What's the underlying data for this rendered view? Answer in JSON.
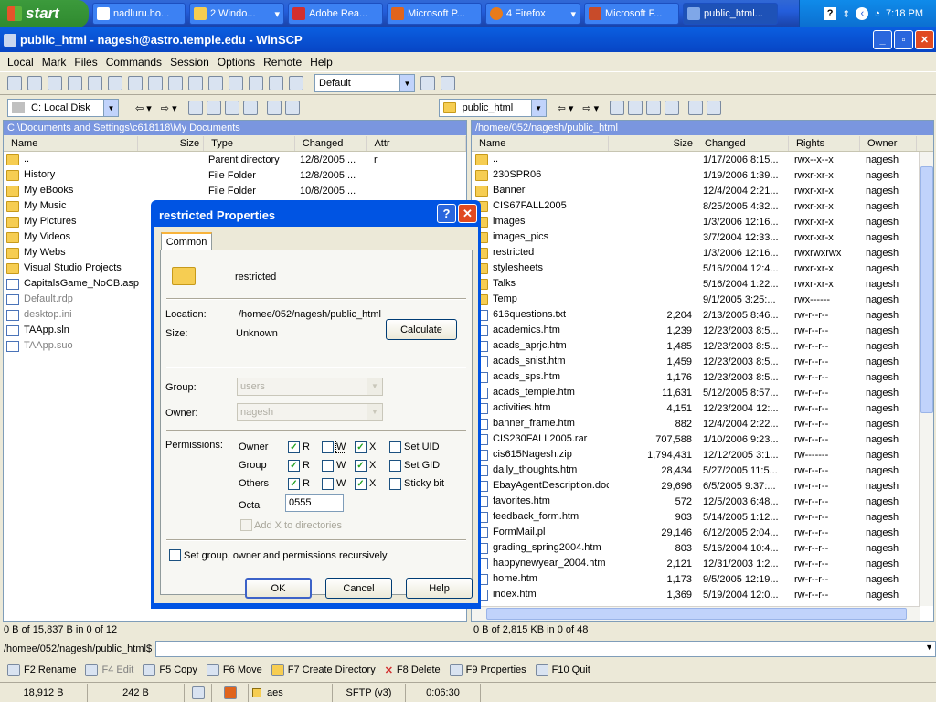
{
  "taskbar": {
    "start": "start",
    "buttons": [
      "nadluru.ho...",
      "2 Windo...",
      "Adobe Rea...",
      "Microsoft P...",
      "4 Firefox",
      "Microsoft F...",
      "public_html..."
    ],
    "time": "7:18 PM"
  },
  "window": {
    "title": "public_html - nagesh@astro.temple.edu - WinSCP"
  },
  "menu": {
    "items": [
      "Local",
      "Mark",
      "Files",
      "Commands",
      "Session",
      "Options",
      "Remote",
      "Help"
    ]
  },
  "toolbar": {
    "session_combo": "Default"
  },
  "left_panel": {
    "drive": "C: Local Disk",
    "path": "C:\\Documents and Settings\\c618118\\My Documents",
    "columns": [
      "Name",
      "Size",
      "Type",
      "Changed",
      "Attr"
    ],
    "files": [
      {
        "name": "..",
        "size": "",
        "type": "Parent directory",
        "changed": "12/8/2005 ...",
        "attr": "r",
        "kind": "up"
      },
      {
        "name": "History",
        "size": "",
        "type": "File Folder",
        "changed": "12/8/2005 ...",
        "attr": "",
        "kind": "folder"
      },
      {
        "name": "My eBooks",
        "size": "",
        "type": "File Folder",
        "changed": "10/8/2005 ...",
        "attr": "",
        "kind": "folder"
      },
      {
        "name": "My Music",
        "size": "",
        "type": "",
        "changed": "",
        "attr": "",
        "kind": "folder"
      },
      {
        "name": "My Pictures",
        "size": "",
        "type": "",
        "changed": "",
        "attr": "",
        "kind": "folder"
      },
      {
        "name": "My Videos",
        "size": "",
        "type": "",
        "changed": "",
        "attr": "",
        "kind": "folder"
      },
      {
        "name": "My Webs",
        "size": "",
        "type": "",
        "changed": "",
        "attr": "",
        "kind": "folder"
      },
      {
        "name": "Visual Studio Projects",
        "size": "",
        "type": "",
        "changed": "",
        "attr": "",
        "kind": "folder"
      },
      {
        "name": "CapitalsGame_NoCB.aspx",
        "size": "",
        "type": "",
        "changed": "",
        "attr": "",
        "kind": "doc"
      },
      {
        "name": "Default.rdp",
        "size": "",
        "type": "",
        "changed": "",
        "attr": "",
        "kind": "doc",
        "gray": true
      },
      {
        "name": "desktop.ini",
        "size": "",
        "type": "",
        "changed": "",
        "attr": "",
        "kind": "doc",
        "gray": true
      },
      {
        "name": "TAApp.sln",
        "size": "",
        "type": "",
        "changed": "",
        "attr": "",
        "kind": "doc"
      },
      {
        "name": "TAApp.suo",
        "size": "",
        "type": "",
        "changed": "",
        "attr": "",
        "kind": "doc",
        "gray": true
      }
    ],
    "status": "0 B of 15,837 B in 0 of 12"
  },
  "right_panel": {
    "dir": "public_html",
    "path": "/homee/052/nagesh/public_html",
    "columns": [
      "Name",
      "Size",
      "Changed",
      "Rights",
      "Owner"
    ],
    "files": [
      {
        "name": "..",
        "size": "",
        "changed": "1/17/2006 8:15...",
        "rights": "rwx--x--x",
        "owner": "nagesh",
        "kind": "up"
      },
      {
        "name": "230SPR06",
        "size": "",
        "changed": "1/19/2006 1:39...",
        "rights": "rwxr-xr-x",
        "owner": "nagesh",
        "kind": "folder"
      },
      {
        "name": "Banner",
        "size": "",
        "changed": "12/4/2004 2:21...",
        "rights": "rwxr-xr-x",
        "owner": "nagesh",
        "kind": "folder"
      },
      {
        "name": "CIS67FALL2005",
        "size": "",
        "changed": "8/25/2005 4:32...",
        "rights": "rwxr-xr-x",
        "owner": "nagesh",
        "kind": "folder"
      },
      {
        "name": "images",
        "size": "",
        "changed": "1/3/2006 12:16...",
        "rights": "rwxr-xr-x",
        "owner": "nagesh",
        "kind": "folder"
      },
      {
        "name": "images_pics",
        "size": "",
        "changed": "3/7/2004 12:33...",
        "rights": "rwxr-xr-x",
        "owner": "nagesh",
        "kind": "folder"
      },
      {
        "name": "restricted",
        "size": "",
        "changed": "1/3/2006 12:16...",
        "rights": "rwxrwxrwx",
        "owner": "nagesh",
        "kind": "folder"
      },
      {
        "name": "stylesheets",
        "size": "",
        "changed": "5/16/2004 12:4...",
        "rights": "rwxr-xr-x",
        "owner": "nagesh",
        "kind": "folder"
      },
      {
        "name": "Talks",
        "size": "",
        "changed": "5/16/2004 1:22...",
        "rights": "rwxr-xr-x",
        "owner": "nagesh",
        "kind": "folder"
      },
      {
        "name": "Temp",
        "size": "",
        "changed": "9/1/2005 3:25:...",
        "rights": "rwx------",
        "owner": "nagesh",
        "kind": "folder"
      },
      {
        "name": "616questions.txt",
        "size": "2,204",
        "changed": "2/13/2005 8:46...",
        "rights": "rw-r--r--",
        "owner": "nagesh",
        "kind": "doc"
      },
      {
        "name": "academics.htm",
        "size": "1,239",
        "changed": "12/23/2003 8:5...",
        "rights": "rw-r--r--",
        "owner": "nagesh",
        "kind": "doc"
      },
      {
        "name": "acads_aprjc.htm",
        "size": "1,485",
        "changed": "12/23/2003 8:5...",
        "rights": "rw-r--r--",
        "owner": "nagesh",
        "kind": "doc"
      },
      {
        "name": "acads_snist.htm",
        "size": "1,459",
        "changed": "12/23/2003 8:5...",
        "rights": "rw-r--r--",
        "owner": "nagesh",
        "kind": "doc"
      },
      {
        "name": "acads_sps.htm",
        "size": "1,176",
        "changed": "12/23/2003 8:5...",
        "rights": "rw-r--r--",
        "owner": "nagesh",
        "kind": "doc"
      },
      {
        "name": "acads_temple.htm",
        "size": "11,631",
        "changed": "5/12/2005 8:57...",
        "rights": "rw-r--r--",
        "owner": "nagesh",
        "kind": "doc"
      },
      {
        "name": "activities.htm",
        "size": "4,151",
        "changed": "12/23/2004 12:...",
        "rights": "rw-r--r--",
        "owner": "nagesh",
        "kind": "doc"
      },
      {
        "name": "banner_frame.htm",
        "size": "882",
        "changed": "12/4/2004 2:22...",
        "rights": "rw-r--r--",
        "owner": "nagesh",
        "kind": "doc"
      },
      {
        "name": "CIS230FALL2005.rar",
        "size": "707,588",
        "changed": "1/10/2006 9:23...",
        "rights": "rw-r--r--",
        "owner": "nagesh",
        "kind": "doc"
      },
      {
        "name": "cis615Nagesh.zip",
        "size": "1,794,431",
        "changed": "12/12/2005 3:1...",
        "rights": "rw-------",
        "owner": "nagesh",
        "kind": "doc"
      },
      {
        "name": "daily_thoughts.htm",
        "size": "28,434",
        "changed": "5/27/2005 11:5...",
        "rights": "rw-r--r--",
        "owner": "nagesh",
        "kind": "doc"
      },
      {
        "name": "EbayAgentDescription.doc",
        "size": "29,696",
        "changed": "6/5/2005 9:37:...",
        "rights": "rw-r--r--",
        "owner": "nagesh",
        "kind": "doc"
      },
      {
        "name": "favorites.htm",
        "size": "572",
        "changed": "12/5/2003 6:48...",
        "rights": "rw-r--r--",
        "owner": "nagesh",
        "kind": "doc"
      },
      {
        "name": "feedback_form.htm",
        "size": "903",
        "changed": "5/14/2005 1:12...",
        "rights": "rw-r--r--",
        "owner": "nagesh",
        "kind": "doc"
      },
      {
        "name": "FormMail.pl",
        "size": "29,146",
        "changed": "6/12/2005 2:04...",
        "rights": "rw-r--r--",
        "owner": "nagesh",
        "kind": "doc"
      },
      {
        "name": "grading_spring2004.htm",
        "size": "803",
        "changed": "5/16/2004 10:4...",
        "rights": "rw-r--r--",
        "owner": "nagesh",
        "kind": "doc"
      },
      {
        "name": "happynewyear_2004.htm",
        "size": "2,121",
        "changed": "12/31/2003 1:2...",
        "rights": "rw-r--r--",
        "owner": "nagesh",
        "kind": "doc"
      },
      {
        "name": "home.htm",
        "size": "1,173",
        "changed": "9/5/2005 12:19...",
        "rights": "rw-r--r--",
        "owner": "nagesh",
        "kind": "doc"
      },
      {
        "name": "index.htm",
        "size": "1,369",
        "changed": "5/19/2004 12:0...",
        "rights": "rw-r--r--",
        "owner": "nagesh",
        "kind": "doc"
      }
    ],
    "status": "0 B of 2,815 KB in 0 of 48"
  },
  "command_line": {
    "prompt": "/homee/052/nagesh/public_html$"
  },
  "fn_keys": [
    "F2 Rename",
    "F4 Edit",
    "F5 Copy",
    "F6 Move",
    "F7 Create Directory",
    "F8 Delete",
    "F9 Properties",
    "F10 Quit"
  ],
  "bottom": {
    "sent": "18,912 B",
    "received": "242 B",
    "cipher": "aes",
    "protocol": "SFTP (v3)",
    "elapsed": "0:06:30"
  },
  "dialog": {
    "title": "restricted Properties",
    "tab": "Common",
    "name": "restricted",
    "location_label": "Location:",
    "location": "/homee/052/nagesh/public_html",
    "size_label": "Size:",
    "size": "Unknown",
    "calculate": "Calculate",
    "group_label": "Group:",
    "group": "users",
    "owner_label": "Owner:",
    "owner": "nagesh",
    "permissions_label": "Permissions:",
    "perm_rows": [
      "Owner",
      "Group",
      "Others"
    ],
    "perm_r": "R",
    "perm_w": "W",
    "perm_x": "X",
    "set_uid": "Set UID",
    "set_gid": "Set GID",
    "sticky": "Sticky bit",
    "octal_label": "Octal",
    "octal": "0555",
    "add_x": "Add X to directories",
    "recursive": "Set group, owner and permissions recursively",
    "ok": "OK",
    "cancel": "Cancel",
    "help": "Help"
  }
}
